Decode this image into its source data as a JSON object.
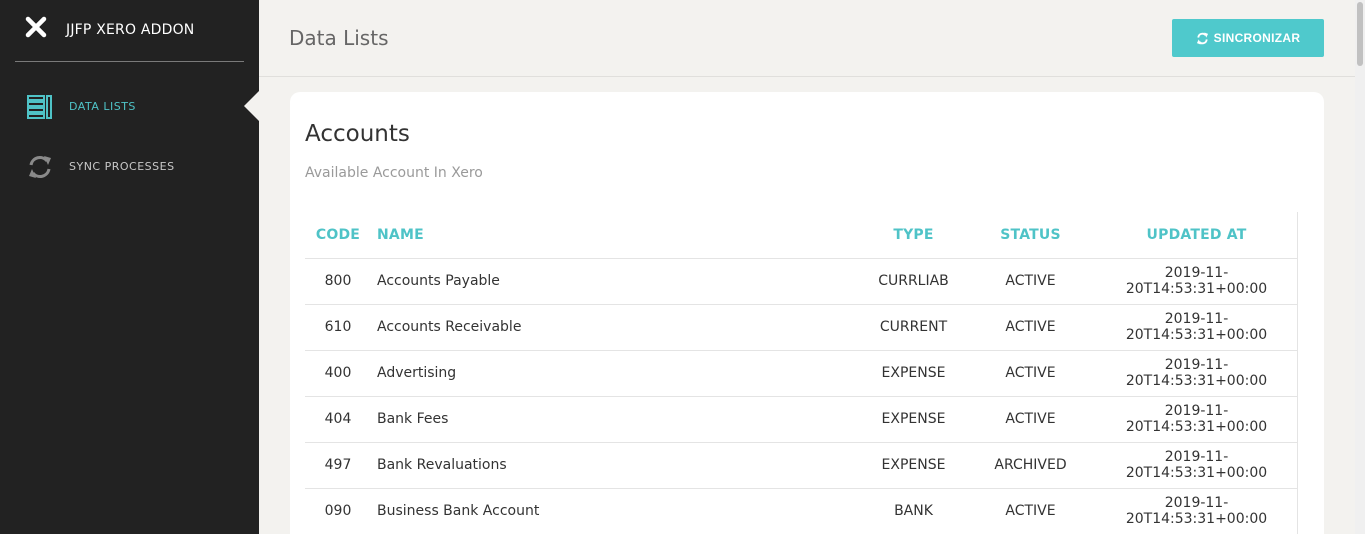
{
  "sidebar": {
    "brand": "JJFP XERO ADDON",
    "items": [
      {
        "label": "DATA LISTS",
        "icon": "list-icon",
        "active": true
      },
      {
        "label": "SYNC PROCESSES",
        "icon": "sync-icon",
        "active": false
      }
    ]
  },
  "header": {
    "title": "Data Lists",
    "sync_button": "SINCRONIZAR"
  },
  "card": {
    "title": "Accounts",
    "subtitle": "Available Account In Xero"
  },
  "table": {
    "columns": [
      "CODE",
      "NAME",
      "TYPE",
      "STATUS",
      "UPDATED AT"
    ],
    "rows": [
      {
        "code": "800",
        "name": "Accounts Payable",
        "type": "CURRLIAB",
        "status": "ACTIVE",
        "updated": "2019-11-20T14:53:31+00:00"
      },
      {
        "code": "610",
        "name": "Accounts Receivable",
        "type": "CURRENT",
        "status": "ACTIVE",
        "updated": "2019-11-20T14:53:31+00:00"
      },
      {
        "code": "400",
        "name": "Advertising",
        "type": "EXPENSE",
        "status": "ACTIVE",
        "updated": "2019-11-20T14:53:31+00:00"
      },
      {
        "code": "404",
        "name": "Bank Fees",
        "type": "EXPENSE",
        "status": "ACTIVE",
        "updated": "2019-11-20T14:53:31+00:00"
      },
      {
        "code": "497",
        "name": "Bank Revaluations",
        "type": "EXPENSE",
        "status": "ARCHIVED",
        "updated": "2019-11-20T14:53:31+00:00"
      },
      {
        "code": "090",
        "name": "Business Bank Account",
        "type": "BANK",
        "status": "ACTIVE",
        "updated": "2019-11-20T14:53:31+00:00"
      }
    ]
  },
  "colors": {
    "accent": "#4fc3c7",
    "button": "#4fc9cc",
    "sidebar_bg": "#222222",
    "page_bg": "#f3f2ef"
  }
}
